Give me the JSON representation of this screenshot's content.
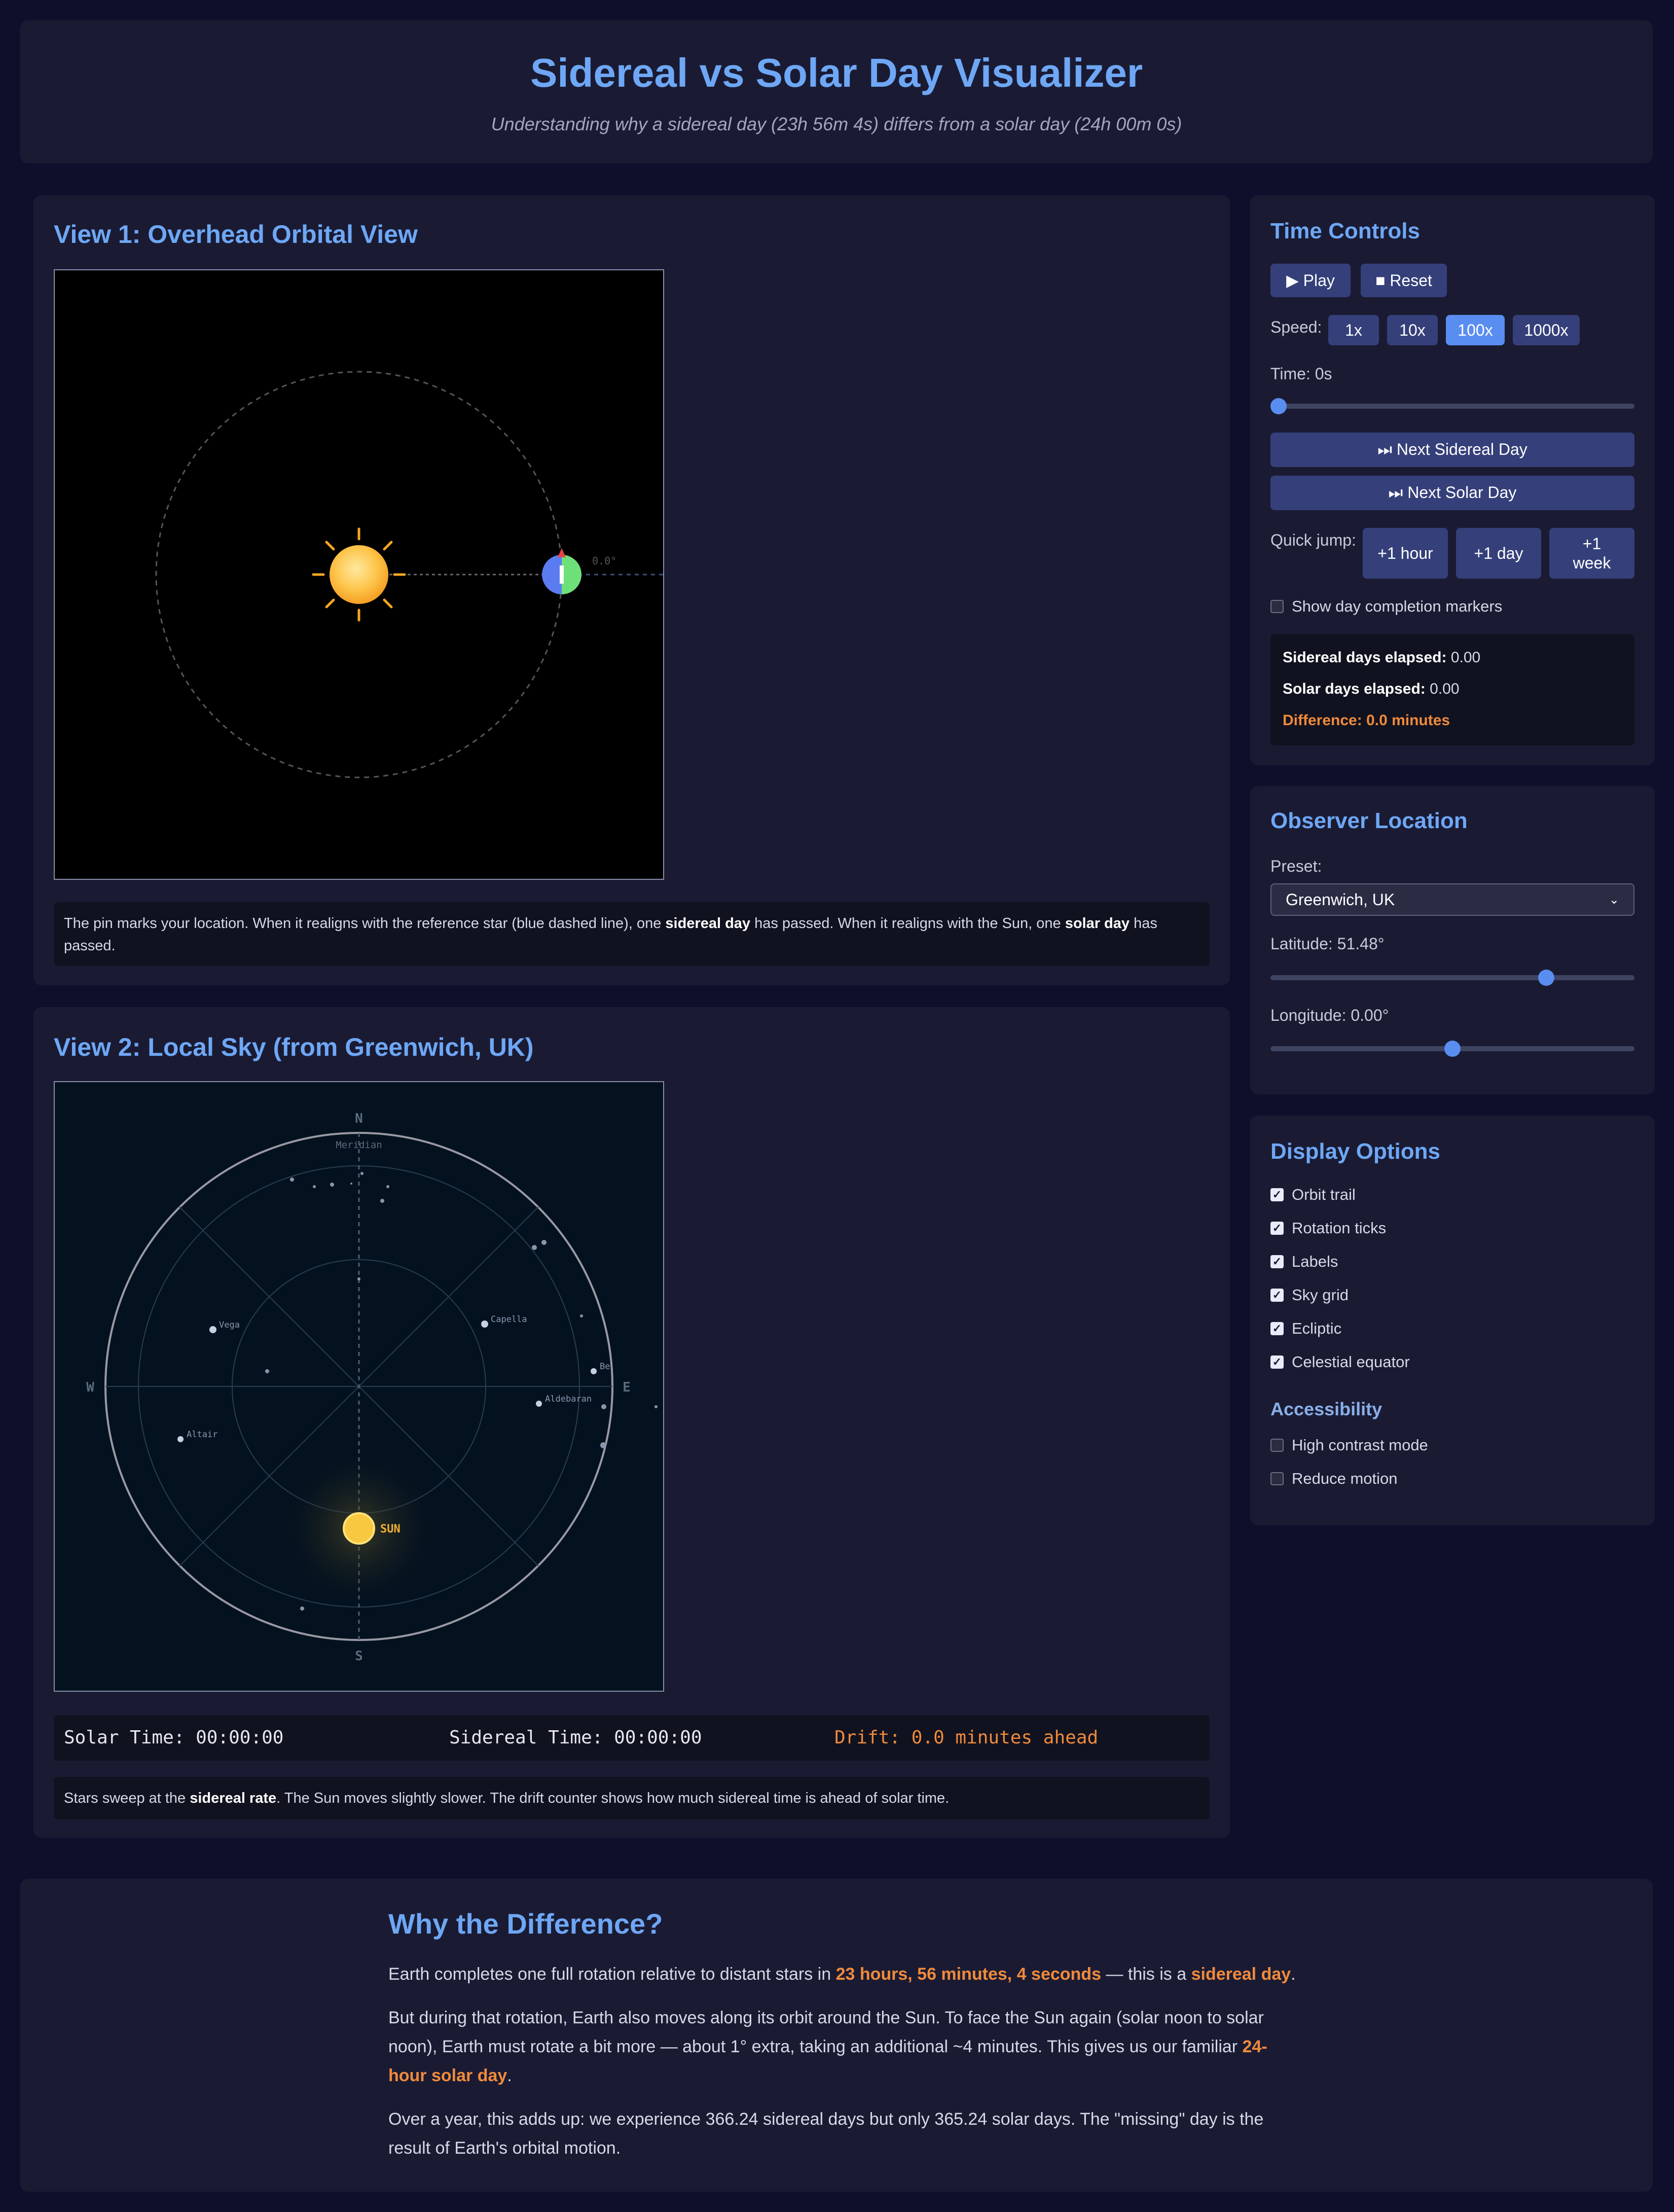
{
  "header": {
    "title": "Sidereal vs Solar Day Visualizer",
    "subtitle": "Understanding why a sidereal day (23h 56m 4s) differs from a solar day (24h 00m 0s)"
  },
  "view1": {
    "title": "View 1: Overhead Orbital View",
    "angle_label": "0.0°",
    "note_a": "The pin marks your location. When it realigns with the reference star (blue dashed line), one ",
    "note_b": "sidereal day",
    "note_c": " has passed. When it realigns with the Sun, one ",
    "note_d": "solar day",
    "note_e": " has passed."
  },
  "view2": {
    "title": "View 2: Local Sky (from Greenwich, UK)",
    "compass": {
      "n": "N",
      "s": "S",
      "e": "E",
      "w": "W"
    },
    "meridian": "Meridian",
    "stars": {
      "vega": "Vega",
      "capella": "Capella",
      "altair": "Altair",
      "aldebaran": "Aldebaran",
      "be": "Be"
    },
    "sun_label": "SUN",
    "solar_time": "Solar Time: 00:00:00",
    "sidereal_time": "Sidereal Time: 00:00:00",
    "drift": "Drift: 0.0 minutes ahead",
    "note_a": "Stars sweep at the ",
    "note_b": "sidereal rate",
    "note_c": ". The Sun moves slightly slower. The drift counter shows how much sidereal time is ahead of solar time."
  },
  "controls": {
    "title": "Time Controls",
    "play": "▶ Play",
    "reset": "■ Reset",
    "speed_label": "Speed:",
    "speeds": [
      "1x",
      "10x",
      "100x",
      "1000x"
    ],
    "selected_speed": "100x",
    "time_label": "Time: 0s",
    "time_progress": 0,
    "next_sidereal": "⏭ Next Sidereal Day",
    "next_solar": "⏭ Next Solar Day",
    "quick_label": "Quick jump:",
    "quick": [
      "+1 hour",
      "+1 day",
      "+1 week"
    ],
    "markers_label": "Show day completion markers",
    "sidereal_elapsed_label": "Sidereal days elapsed:",
    "sidereal_elapsed": "0.00",
    "solar_elapsed_label": "Solar days elapsed:",
    "solar_elapsed": "0.00",
    "difference": "Difference: 0.0 minutes"
  },
  "observer": {
    "title": "Observer Location",
    "preset_label": "Preset:",
    "preset_value": "Greenwich, UK",
    "latitude_label": "Latitude: 51.48°",
    "latitude_fraction": 0.77,
    "longitude_label": "Longitude: 0.00°",
    "longitude_fraction": 0.5
  },
  "display": {
    "title": "Display Options",
    "options": [
      "Orbit trail",
      "Rotation ticks",
      "Labels",
      "Sky grid",
      "Ecliptic",
      "Celestial equator"
    ],
    "accessibility_title": "Accessibility",
    "access_options": [
      "High contrast mode",
      "Reduce motion"
    ]
  },
  "why": {
    "title": "Why the Difference?",
    "p1_a": "Earth completes one full rotation relative to distant stars in ",
    "p1_b": "23 hours, 56 minutes, 4 seconds",
    "p1_c": " — this is a ",
    "p1_d": "sidereal day",
    "p1_e": ".",
    "p2_a": "But during that rotation, Earth also moves along its orbit around the Sun. To face the Sun again (solar noon to solar noon), Earth must rotate a bit more — about 1° extra, taking an additional ~4 minutes. This gives us our familiar ",
    "p2_b": "24-hour solar day",
    "p2_c": ".",
    "p3": "Over a year, this adds up: we experience 366.24 sidereal days but only 365.24 solar days. The \"missing\" day is the result of Earth's orbital motion."
  },
  "colors": {
    "accent": "#6ea7f5",
    "highlight": "#f08a3c",
    "button": "#35407a",
    "selected": "#5a8df0"
  }
}
